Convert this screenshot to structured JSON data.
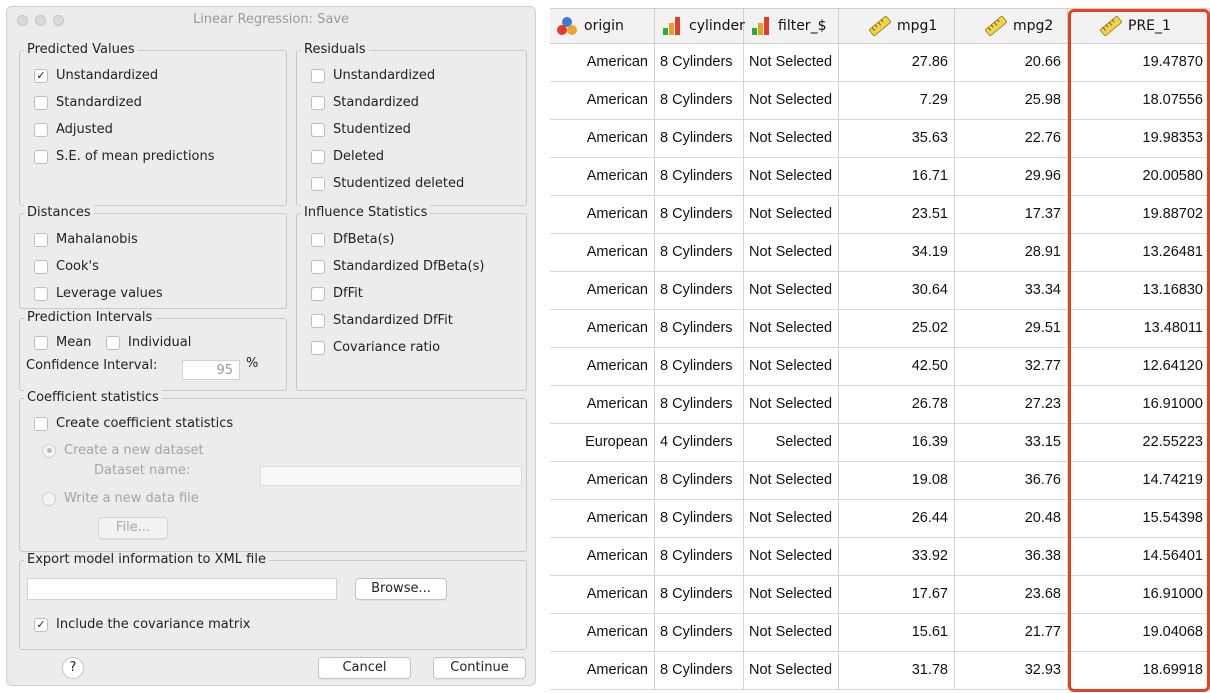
{
  "dialog": {
    "title": "Linear Regression: Save",
    "predicted_values": {
      "label": "Predicted Values",
      "options": [
        {
          "label": "Unstandardized",
          "checked": true
        },
        {
          "label": "Standardized",
          "checked": false
        },
        {
          "label": "Adjusted",
          "checked": false
        },
        {
          "label": "S.E. of mean predictions",
          "checked": false
        }
      ]
    },
    "residuals": {
      "label": "Residuals",
      "options": [
        {
          "label": "Unstandardized",
          "checked": false
        },
        {
          "label": "Standardized",
          "checked": false
        },
        {
          "label": "Studentized",
          "checked": false
        },
        {
          "label": "Deleted",
          "checked": false
        },
        {
          "label": "Studentized deleted",
          "checked": false
        }
      ]
    },
    "distances": {
      "label": "Distances",
      "options": [
        {
          "label": "Mahalanobis",
          "checked": false
        },
        {
          "label": "Cook's",
          "checked": false
        },
        {
          "label": "Leverage values",
          "checked": false
        }
      ]
    },
    "influence": {
      "label": "Influence Statistics",
      "options": [
        {
          "label": "DfBeta(s)",
          "checked": false
        },
        {
          "label": "Standardized DfBeta(s)",
          "checked": false
        },
        {
          "label": "DfFit",
          "checked": false
        },
        {
          "label": "Standardized DfFit",
          "checked": false
        },
        {
          "label": "Covariance ratio",
          "checked": false
        }
      ]
    },
    "prediction_intervals": {
      "label": "Prediction Intervals",
      "mean": "Mean",
      "individual": "Individual",
      "confidence_label": "Confidence Interval:",
      "confidence_value": "95",
      "percent": "%"
    },
    "coefficient": {
      "label": "Coefficient statistics",
      "create": "Create coefficient statistics",
      "new_dataset": "Create a new dataset",
      "dataset_name": "Dataset name:",
      "write_file": "Write a new data file",
      "file_button": "File..."
    },
    "export": {
      "label": "Export model information to XML file",
      "browse": "Browse...",
      "include_cov": "Include the covariance matrix",
      "include_cov_checked": true
    },
    "help": "?",
    "cancel": "Cancel",
    "continue": "Continue"
  },
  "table": {
    "columns": [
      "origin",
      "cylinder",
      "filter_$",
      "mpg1",
      "mpg2",
      "PRE_1"
    ],
    "column_icons": [
      "nominal-icon",
      "ordinal-icon",
      "ordinal-icon",
      "scale-icon",
      "scale-icon",
      "scale-icon"
    ],
    "rows": [
      [
        "American",
        "8 Cylinders",
        "Not Selected",
        "27.86",
        "20.66",
        "19.47870"
      ],
      [
        "American",
        "8 Cylinders",
        "Not Selected",
        "7.29",
        "25.98",
        "18.07556"
      ],
      [
        "American",
        "8 Cylinders",
        "Not Selected",
        "35.63",
        "22.76",
        "19.98353"
      ],
      [
        "American",
        "8 Cylinders",
        "Not Selected",
        "16.71",
        "29.96",
        "20.00580"
      ],
      [
        "American",
        "8 Cylinders",
        "Not Selected",
        "23.51",
        "17.37",
        "19.88702"
      ],
      [
        "American",
        "8 Cylinders",
        "Not Selected",
        "34.19",
        "28.91",
        "13.26481"
      ],
      [
        "American",
        "8 Cylinders",
        "Not Selected",
        "30.64",
        "33.34",
        "13.16830"
      ],
      [
        "American",
        "8 Cylinders",
        "Not Selected",
        "25.02",
        "29.51",
        "13.48011"
      ],
      [
        "American",
        "8 Cylinders",
        "Not Selected",
        "42.50",
        "32.77",
        "12.64120"
      ],
      [
        "American",
        "8 Cylinders",
        "Not Selected",
        "26.78",
        "27.23",
        "16.91000"
      ],
      [
        "European",
        "4 Cylinders",
        "Selected",
        "16.39",
        "33.15",
        "22.55223"
      ],
      [
        "American",
        "8 Cylinders",
        "Not Selected",
        "19.08",
        "36.76",
        "14.74219"
      ],
      [
        "American",
        "8 Cylinders",
        "Not Selected",
        "26.44",
        "20.48",
        "15.54398"
      ],
      [
        "American",
        "8 Cylinders",
        "Not Selected",
        "33.92",
        "36.38",
        "14.56401"
      ],
      [
        "American",
        "8 Cylinders",
        "Not Selected",
        "17.67",
        "23.68",
        "16.91000"
      ],
      [
        "American",
        "8 Cylinders",
        "Not Selected",
        "15.61",
        "21.77",
        "19.04068"
      ],
      [
        "American",
        "8 Cylinders",
        "Not Selected",
        "31.78",
        "32.93",
        "18.69918"
      ]
    ],
    "highlight_color": "#e0441f"
  }
}
